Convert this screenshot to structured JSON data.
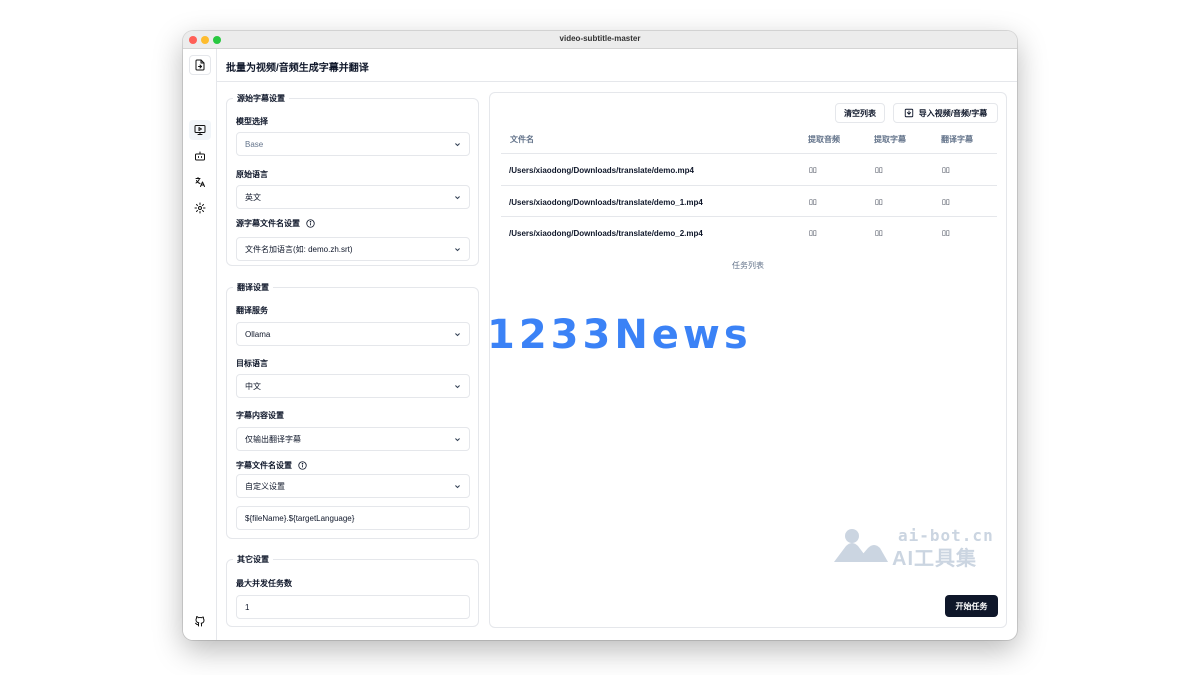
{
  "window": {
    "title": "video-subtitle-master"
  },
  "header": {
    "title": "批量为视频/音频生成字幕并翻译"
  },
  "source_settings": {
    "legend": "源始字幕设置",
    "model_label": "模型选择",
    "model_value": "Base",
    "source_language_label": "原始语言",
    "source_language_value": "英文",
    "filename_label": "源字幕文件名设置",
    "filename_value": "文件名加语言(如: demo.zh.srt)"
  },
  "translate_settings": {
    "legend": "翻译设置",
    "service_label": "翻译服务",
    "service_value": "Ollama",
    "target_language_label": "目标语言",
    "target_language_value": "中文",
    "content_label": "字幕内容设置",
    "content_value": "仅输出翻译字幕",
    "filename_label": "字幕文件名设置",
    "filename_value": "自定义设置",
    "custom_template": "${fileName}.${targetLanguage}"
  },
  "other_settings": {
    "legend": "其它设置",
    "concurrency_label": "最大并发任务数",
    "concurrency_value": "1"
  },
  "tasks": {
    "clear_label": "清空列表",
    "import_label": "导入视频/音频/字幕",
    "columns": [
      "文件名",
      "提取音频",
      "提取字幕",
      "翻译字幕"
    ],
    "rows": [
      {
        "file": "/Users/xiaodong/Downloads/translate/demo.mp4",
        "audio": "▯▯",
        "extract": "▯▯",
        "translate": "▯▯"
      },
      {
        "file": "/Users/xiaodong/Downloads/translate/demo_1.mp4",
        "audio": "▯▯",
        "extract": "▯▯",
        "translate": "▯▯"
      },
      {
        "file": "/Users/xiaodong/Downloads/translate/demo_2.mp4",
        "audio": "▯▯",
        "extract": "▯▯",
        "translate": "▯▯"
      }
    ],
    "caption": "任务列表",
    "start_label": "开始任务"
  },
  "watermarks": {
    "overlay": "1233News",
    "corner_url": "ai-bot.cn",
    "corner_name": "AI工具集"
  },
  "icons": {
    "sidebar": [
      "file-export-icon",
      "monitor-play-icon",
      "bot-icon",
      "languages-icon",
      "settings-gear-icon",
      "github-icon"
    ],
    "buttons": [
      "import-icon",
      "chevron-down-icon",
      "info-icon"
    ]
  },
  "colors": {
    "primary": "#0f172a",
    "border": "#e5e7eb",
    "muted": "#64748b",
    "watermark_blue": "#3b82f6"
  }
}
